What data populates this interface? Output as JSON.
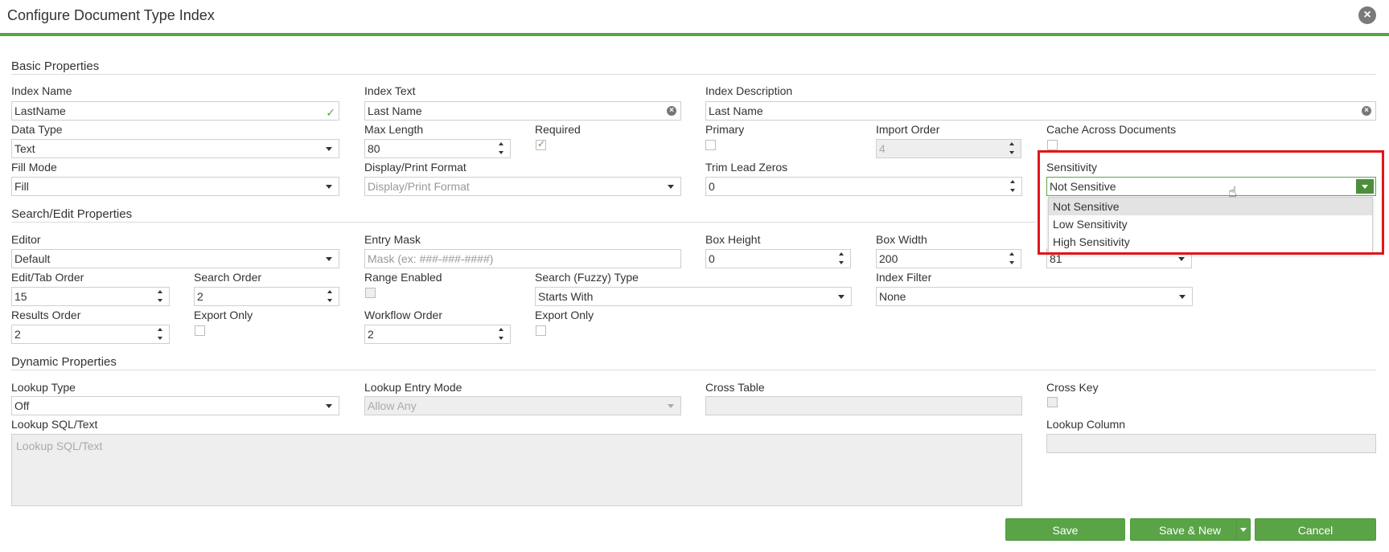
{
  "dialog": {
    "title": "Configure Document Type Index",
    "close_icon": "close-icon"
  },
  "basic": {
    "heading": "Basic Properties",
    "index_name": {
      "label": "Index Name",
      "value": "LastName"
    },
    "index_text": {
      "label": "Index Text",
      "value": "Last Name"
    },
    "index_description": {
      "label": "Index Description",
      "value": "Last Name"
    },
    "data_type": {
      "label": "Data Type",
      "value": "Text"
    },
    "max_length": {
      "label": "Max Length",
      "value": "80"
    },
    "required": {
      "label": "Required",
      "checked": true
    },
    "primary": {
      "label": "Primary",
      "checked": false
    },
    "import_order": {
      "label": "Import Order",
      "value": "4"
    },
    "cache_across": {
      "label": "Cache Across Documents",
      "checked": false
    },
    "fill_mode": {
      "label": "Fill Mode",
      "value": "Fill"
    },
    "display_format": {
      "label": "Display/Print Format",
      "placeholder": "Display/Print Format"
    },
    "trim_lead_zeros": {
      "label": "Trim Lead Zeros",
      "value": "0"
    },
    "sensitivity": {
      "label": "Sensitivity",
      "value": "Not Sensitive",
      "options": [
        "Not Sensitive",
        "Low Sensitivity",
        "High Sensitivity"
      ]
    }
  },
  "search_edit": {
    "heading": "Search/Edit Properties",
    "editor": {
      "label": "Editor",
      "value": "Default"
    },
    "entry_mask": {
      "label": "Entry Mask",
      "placeholder": "Mask (ex: ###-###-####)"
    },
    "box_height": {
      "label": "Box Height",
      "value": "0"
    },
    "box_width": {
      "label": "Box Width",
      "value": "200"
    },
    "hidden_value": "81",
    "edit_tab_order": {
      "label": "Edit/Tab Order",
      "value": "15"
    },
    "search_order": {
      "label": "Search Order",
      "value": "2"
    },
    "range_enabled": {
      "label": "Range Enabled"
    },
    "search_fuzzy": {
      "label": "Search (Fuzzy) Type",
      "value": "Starts With"
    },
    "index_filter": {
      "label": "Index Filter",
      "value": "None"
    },
    "results_order": {
      "label": "Results Order",
      "value": "2"
    },
    "export_only_1": {
      "label": "Export Only"
    },
    "workflow_order": {
      "label": "Workflow Order",
      "value": "2"
    },
    "export_only_2": {
      "label": "Export Only"
    }
  },
  "dynamic": {
    "heading": "Dynamic Properties",
    "lookup_type": {
      "label": "Lookup Type",
      "value": "Off"
    },
    "lookup_entry_mode": {
      "label": "Lookup Entry Mode",
      "value": "Allow Any"
    },
    "cross_table": {
      "label": "Cross Table"
    },
    "cross_key": {
      "label": "Cross Key"
    },
    "lookup_sql": {
      "label": "Lookup SQL/Text",
      "placeholder": "Lookup SQL/Text"
    },
    "lookup_column": {
      "label": "Lookup Column"
    }
  },
  "buttons": {
    "save": "Save",
    "save_new": "Save & New",
    "cancel": "Cancel"
  },
  "colors": {
    "accent": "#5aa447",
    "highlight": "#e0161a"
  }
}
